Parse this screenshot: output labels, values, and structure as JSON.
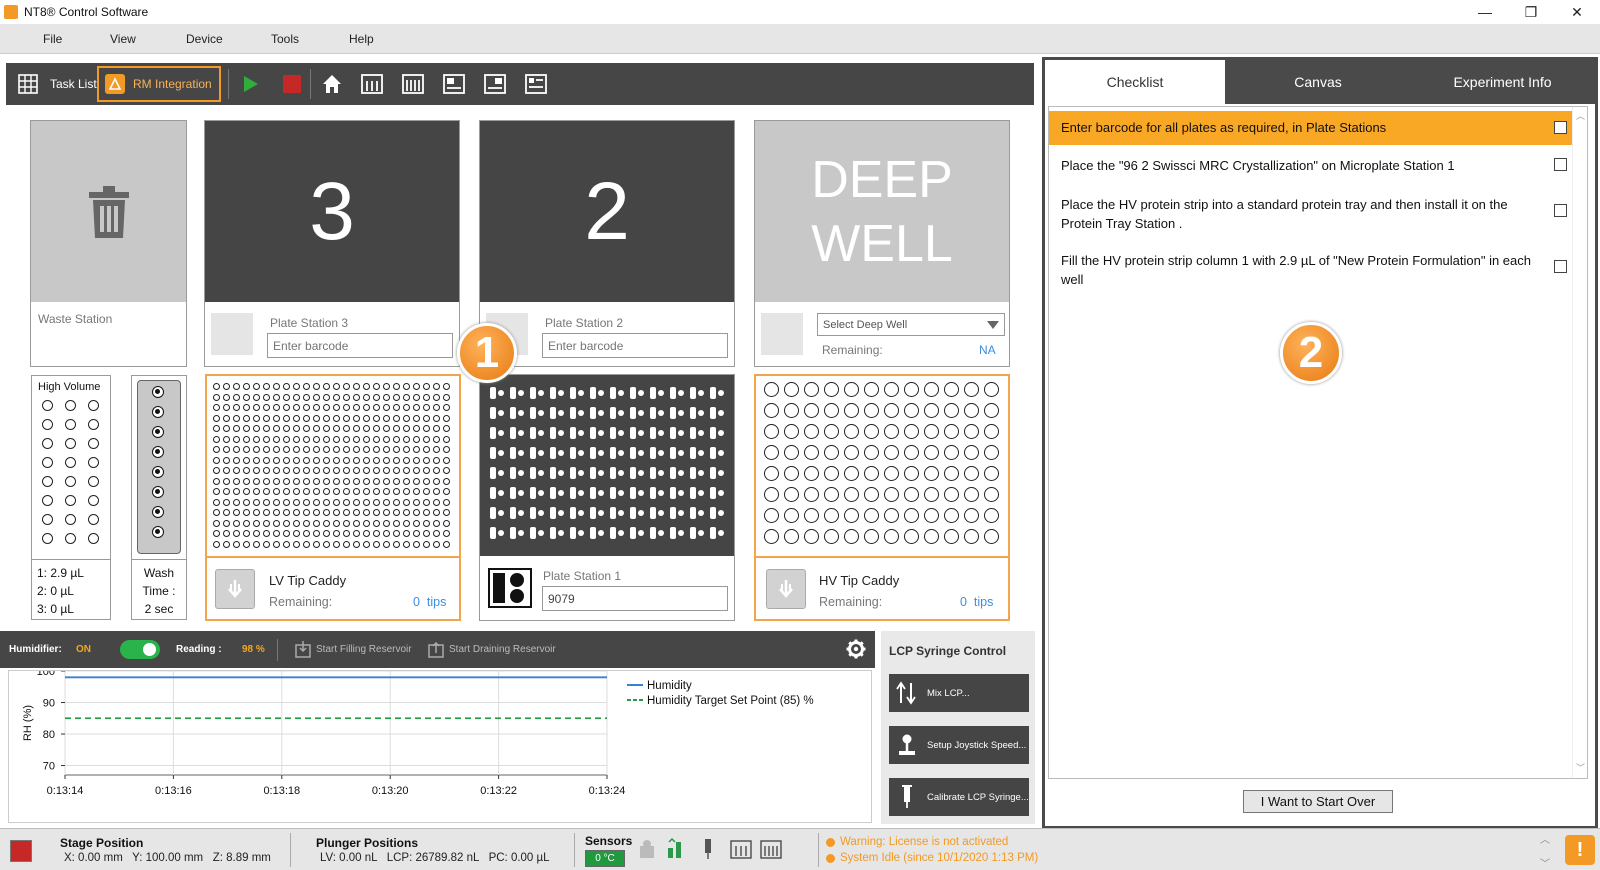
{
  "window": {
    "title": "NT8® Control Software",
    "minimize": "—",
    "restore": "❐",
    "close": "✕"
  },
  "menu": [
    "File",
    "View",
    "Device",
    "Tools",
    "Help"
  ],
  "toolbar": {
    "task_list": "Task List",
    "rm_integration": "RM Integration"
  },
  "stations": {
    "waste": {
      "label": "Waste Station"
    },
    "plate3": {
      "number": "3",
      "label": "Plate Station 3",
      "barcode_placeholder": "Enter barcode"
    },
    "plate2": {
      "number": "2",
      "label": "Plate Station 2",
      "barcode_placeholder": "Enter barcode"
    },
    "deepwell": {
      "title_line1": "DEEP",
      "title_line2": "WELL",
      "select_label": "Select Deep Well",
      "remaining_label": "Remaining:",
      "remaining_value": "NA"
    },
    "high_volume": {
      "title": "High Volume",
      "rows": 8,
      "cols": 3,
      "values": [
        "1: 2.9 µL",
        "2: 0 µL",
        "3: 0 µL"
      ]
    },
    "wash": {
      "dots": 8,
      "label1": "Wash",
      "label2": "Time :",
      "label3": "2 sec"
    },
    "lv_caddy": {
      "label": "LV Tip Caddy",
      "remaining_label": "Remaining:",
      "remaining_value": "0  tips",
      "rows": 16,
      "cols": 24
    },
    "plate1": {
      "label": "Plate Station 1",
      "barcode_value": "9079",
      "rows": 8,
      "cols": 12
    },
    "hv_caddy": {
      "label": "HV Tip Caddy",
      "remaining_label": "Remaining:",
      "remaining_value": "0  tips",
      "rows": 8,
      "cols": 12
    }
  },
  "humidifier": {
    "label": "Humidifier:",
    "state": "ON",
    "reading_label": "Reading :",
    "reading_value": "98 %",
    "start_filling": "Start Filling Reservoir",
    "start_draining": "Start Draining Reservoir"
  },
  "chart_data": {
    "type": "line",
    "ylabel": "RH (%)",
    "ylim": [
      67,
      100
    ],
    "yticks": [
      70,
      80,
      90,
      100
    ],
    "x": [
      "0:13:14",
      "0:13:16",
      "0:13:18",
      "0:13:20",
      "0:13:22",
      "0:13:24"
    ],
    "series": [
      {
        "name": "Humidity",
        "values": [
          98,
          98,
          98,
          98,
          98,
          98
        ],
        "color": "#3a7fd5",
        "style": "solid"
      },
      {
        "name": "Humidity Target Set Point (85) %",
        "values": [
          85,
          85,
          85,
          85,
          85,
          85
        ],
        "color": "#2a9a4a",
        "style": "dashed"
      }
    ],
    "grid": true,
    "legend": "right"
  },
  "lcp": {
    "title": "LCP Syringe Control",
    "buttons": [
      "Mix LCP...",
      "Setup Joystick Speed...",
      "Calibrate LCP Syringe..."
    ]
  },
  "tabs": [
    "Checklist",
    "Canvas",
    "Experiment Info"
  ],
  "checklist": [
    "Enter barcode for all plates as required, in Plate Stations",
    "Place the \"96 2 Swissci MRC Crystallization\" on Microplate Station 1",
    "Place the HV protein strip into a standard protein tray and then install it on the Protein Tray Station .",
    "Fill the HV protein strip column 1 with 2.9 µL of \"New Protein Formulation\" in each well"
  ],
  "start_over": "I Want to Start Over",
  "badges": [
    "1",
    "2"
  ],
  "status": {
    "stage_title": "Stage Position",
    "stage_values": "X: 0.00 mm   Y: 100.00 mm   Z: 8.89 mm",
    "plunger_title": "Plunger Positions",
    "plunger_values": "LV: 0.00 nL   LCP: 26789.82 nL   PC: 0.00 µL",
    "sensors_title": "Sensors",
    "sensor_temp": "0 °C",
    "warning": "Warning: License is not activated",
    "system": "System Idle (since 10/1/2020 1:13 PM)"
  },
  "colors": {
    "accent": "#f29a25",
    "dark": "#454545",
    "highlight_row": "#f9a825",
    "play": "#2fae3c",
    "stop": "#c62828",
    "toggle": "#29b34a"
  }
}
